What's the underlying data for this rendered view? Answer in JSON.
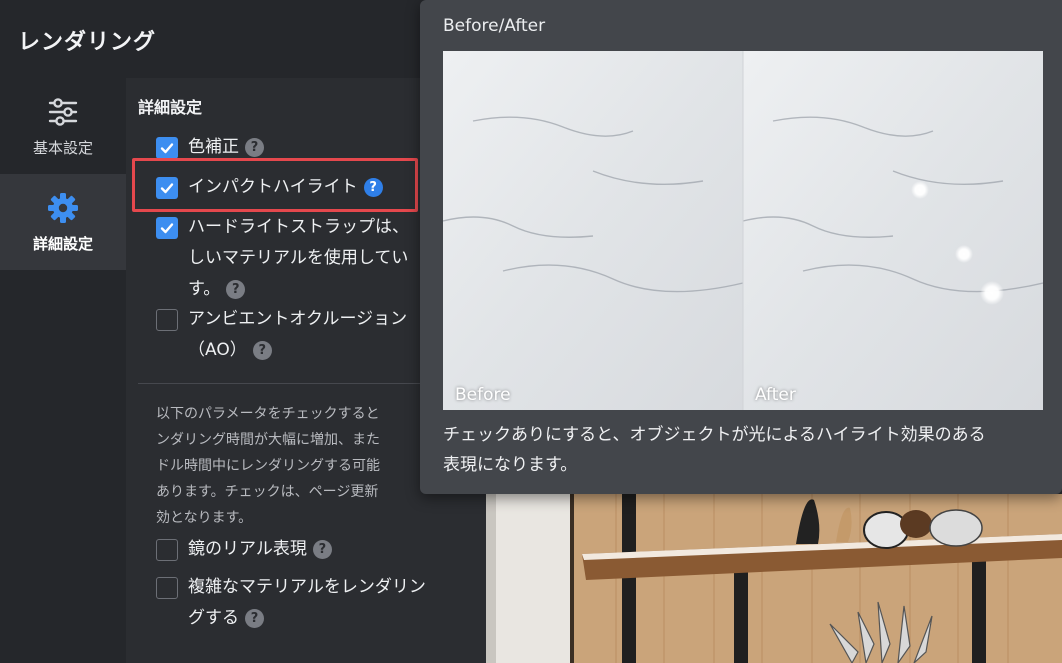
{
  "panel": {
    "title": "レンダリング",
    "nav": [
      {
        "label": "基本設定",
        "icon": "sliders-icon",
        "active": false
      },
      {
        "label": "詳細設定",
        "icon": "gear-icon",
        "active": true
      }
    ]
  },
  "advanced": {
    "section_title": "詳細設定",
    "options": [
      {
        "label": "色補正",
        "checked": true
      },
      {
        "label": "インパクトハイライト",
        "checked": true
      },
      {
        "label_lines": [
          "ハードライトストラップは、",
          "しいマテリアルを使用してい",
          "す。"
        ],
        "checked": true
      },
      {
        "label_lines": [
          "アンビエントオクルージョン",
          "（AO）"
        ],
        "checked": false
      }
    ],
    "note_lines": [
      "以下のパラメータをチェックすると",
      "ンダリング時間が大幅に増加、また",
      "ドル時間中にレンダリングする可能",
      "あります。チェックは、ページ更新",
      "効となります。"
    ],
    "extra_options": [
      {
        "label": "鏡のリアル表現",
        "checked": false
      },
      {
        "label_lines": [
          "複雑なマテリアルをレンダリン",
          "グする"
        ],
        "checked": false
      }
    ]
  },
  "tooltip": {
    "title": "Before/After",
    "before_label": "Before",
    "after_label": "After",
    "description_lines": [
      "チェックありにすると、オブジェクトが光によるハイライト効果のある",
      "表現になります。"
    ]
  },
  "colors": {
    "accent": "#3d8ef0",
    "highlight_border": "#e5484d",
    "panel_bg": "#2b2d31",
    "tooltip_bg": "#43464b"
  }
}
